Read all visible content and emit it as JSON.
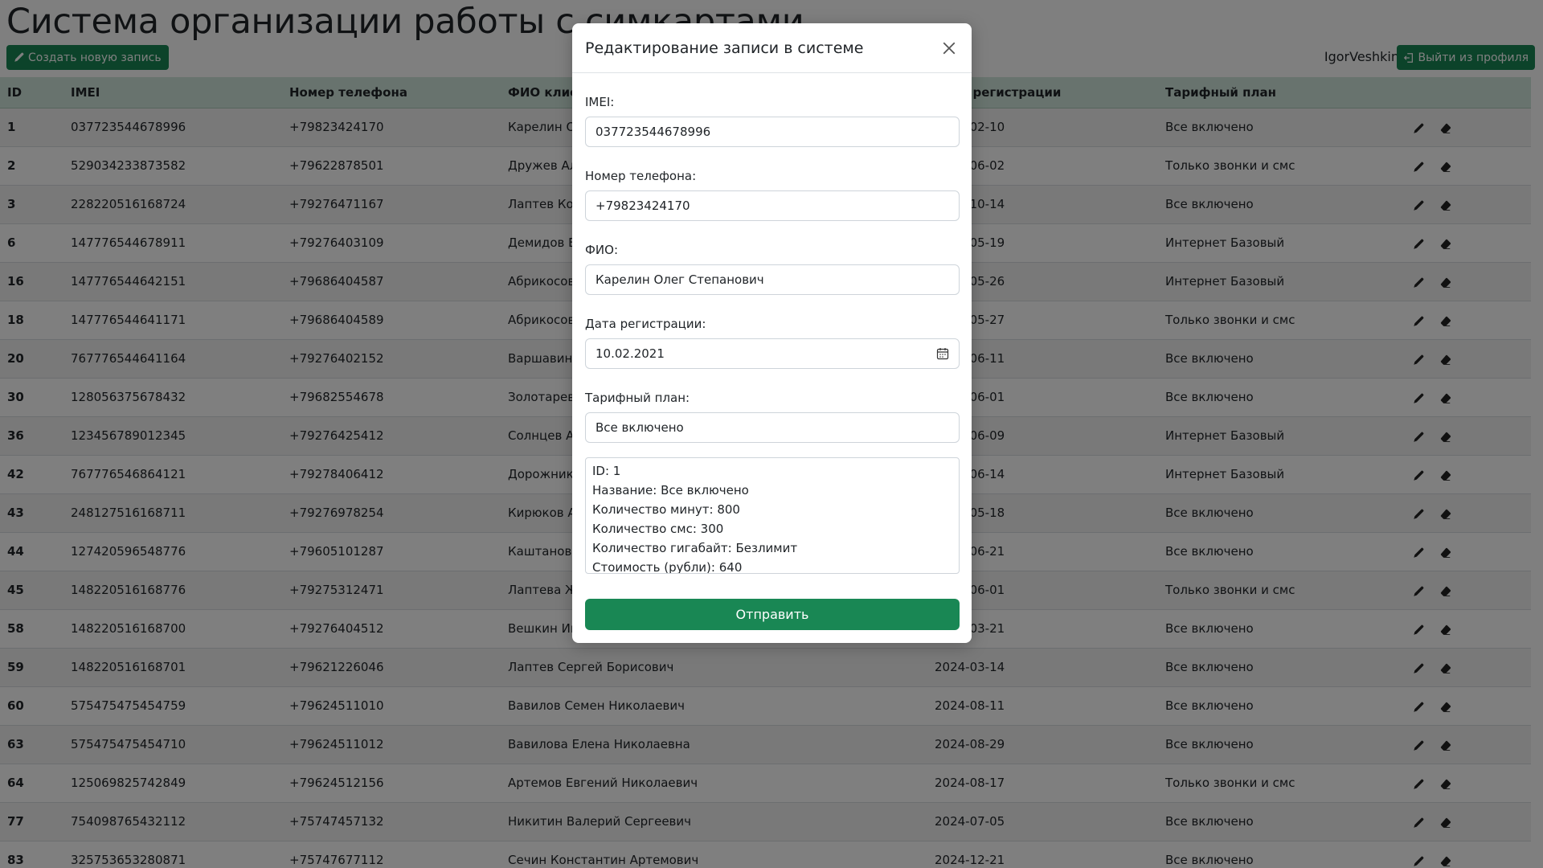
{
  "app_title": "Система организации работы с симкартами",
  "toolbar": {
    "create_label": "Создать новую запись",
    "username": "IgorVeshkin",
    "logout_label": "Выйти из профиля"
  },
  "table": {
    "headers": {
      "id": "ID",
      "imei": "IMEI",
      "phone": "Номер телефона",
      "fio": "ФИО клиента",
      "date": "Дата регистрации",
      "plan": "Тарифный план"
    },
    "rows": [
      {
        "id": "1",
        "imei": "037723544678996",
        "phone": "+79823424170",
        "fio": "Карелин Олег Степанович",
        "date": "2021-02-10",
        "plan": "Все включено"
      },
      {
        "id": "2",
        "imei": "529034233873582",
        "phone": "+79622878501",
        "fio": "Дружев Альберт",
        "date": "2021-06-02",
        "plan": "Только звонки и смс"
      },
      {
        "id": "3",
        "imei": "228220516168724",
        "phone": "+79276471167",
        "fio": "Лаптев Константин",
        "date": "2021-10-14",
        "plan": "Все включено"
      },
      {
        "id": "6",
        "imei": "147776544678911",
        "phone": "+79276403109",
        "fio": "Демидов Борис",
        "date": "2022-05-19",
        "plan": "Интернет Базовый"
      },
      {
        "id": "16",
        "imei": "147776544642151",
        "phone": "+79686404587",
        "fio": "Абрикосов",
        "date": "2022-05-26",
        "plan": "Интернет Базовый"
      },
      {
        "id": "18",
        "imei": "147776544641171",
        "phone": "+79686404589",
        "fio": "Абрикосов",
        "date": "2022-05-27",
        "plan": "Только звонки и смс"
      },
      {
        "id": "20",
        "imei": "767776544641164",
        "phone": "+79276402152",
        "fio": "Варшавин",
        "date": "2022-06-11",
        "plan": "Все включено"
      },
      {
        "id": "30",
        "imei": "128056375678432",
        "phone": "+79682554678",
        "fio": "Золотарев",
        "date": "2022-06-01",
        "plan": "Все включено"
      },
      {
        "id": "36",
        "imei": "123456789012345",
        "phone": "+79276425412",
        "fio": "Солнцев Ал",
        "date": "2022-06-09",
        "plan": "Интернет Базовый"
      },
      {
        "id": "42",
        "imei": "767776546864121",
        "phone": "+79278406412",
        "fio": "Дорожников",
        "date": "2022-06-14",
        "plan": "Интернет Базовый"
      },
      {
        "id": "43",
        "imei": "248127516168711",
        "phone": "+79276978254",
        "fio": "Кирюков А",
        "date": "2022-05-18",
        "plan": "Все включено"
      },
      {
        "id": "44",
        "imei": "127420596548776",
        "phone": "+79605101287",
        "fio": "Каштанов Н",
        "date": "2022-06-21",
        "plan": "Все включено"
      },
      {
        "id": "45",
        "imei": "148220516168776",
        "phone": "+79275312471",
        "fio": "Лаптева Жа",
        "date": "2022-06-01",
        "plan": "Только звонки и смс"
      },
      {
        "id": "58",
        "imei": "148220516168700",
        "phone": "+79276404512",
        "fio": "Вешкин Иг",
        "date": "2023-03-21",
        "plan": "Все включено"
      },
      {
        "id": "59",
        "imei": "148220516168701",
        "phone": "+79621226046",
        "fio": "Лаптев Сергей Борисович",
        "date": "2024-03-14",
        "plan": "Все включено"
      },
      {
        "id": "60",
        "imei": "575475475454759",
        "phone": "+79624511010",
        "fio": "Вавилов Семен Николаевич",
        "date": "2024-08-11",
        "plan": "Все включено"
      },
      {
        "id": "63",
        "imei": "575475475454710",
        "phone": "+79624511012",
        "fio": "Вавилова Елена Николаевна",
        "date": "2024-08-29",
        "plan": "Все включено"
      },
      {
        "id": "64",
        "imei": "125069825742849",
        "phone": "+79624512156",
        "fio": "Артемов Евгений Николаевич",
        "date": "2024-08-17",
        "plan": "Только звонки и смс"
      },
      {
        "id": "77",
        "imei": "754098765432112",
        "phone": "+75747457132",
        "fio": "Никитин Валерий Сергеевич",
        "date": "2024-07-05",
        "plan": "Все включено"
      },
      {
        "id": "83",
        "imei": "325753653280871",
        "phone": "+75747677112",
        "fio": "Сечин Константин Артемович",
        "date": "2024-12-21",
        "plan": "Все включено"
      }
    ]
  },
  "modal": {
    "title": "Редактирование записи в системе",
    "imei_label": "IMEI:",
    "imei_value": "037723544678996",
    "phone_label": "Номер телефона:",
    "phone_value": "+79823424170",
    "fio_label": "ФИО:",
    "fio_value": "Карелин Олег Степанович",
    "date_label": "Дата регистрации:",
    "date_value": "10.02.2021",
    "plan_label": "Тарифный план:",
    "plan_value": "Все включено",
    "info_lines": [
      "ID: 1",
      "Название: Все включено",
      "Количество минут: 800",
      "Количество смс: 300",
      "Количество гигабайт: Безлимит",
      "Стоимость (рубли): 640"
    ],
    "submit_label": "Отправить"
  },
  "colors": {
    "accent": "#198754",
    "header_bg": "#d1e7dd"
  },
  "icons": [
    "pencil-icon",
    "eraser-icon",
    "box-arrow-left-icon",
    "close-icon",
    "calendar-icon"
  ]
}
